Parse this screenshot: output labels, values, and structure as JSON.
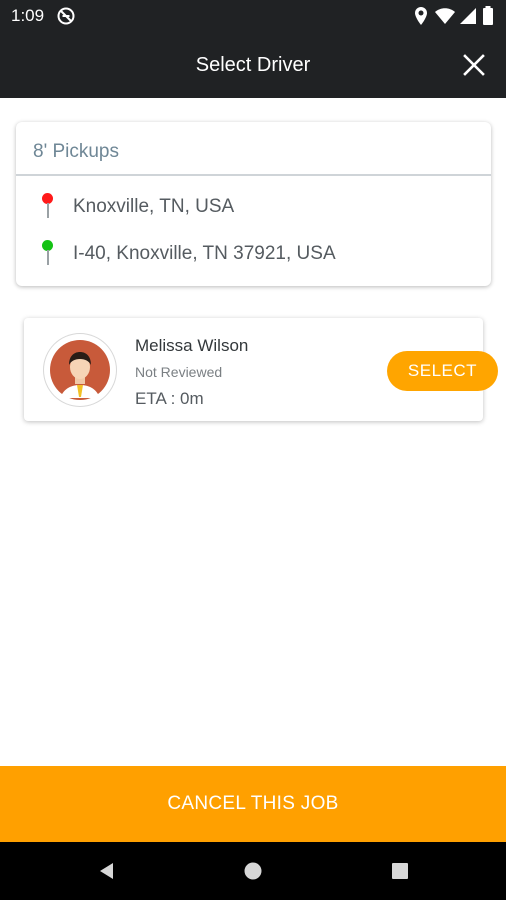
{
  "status_bar": {
    "time": "1:09",
    "left_icon": "do-not-disturb-icon",
    "right_icons": [
      "location-icon",
      "wifi-icon",
      "cellular-signal-icon",
      "battery-icon"
    ]
  },
  "app_bar": {
    "title": "Select Driver",
    "close_icon": "close-icon"
  },
  "route_card": {
    "vehicle_type": "8' Pickups",
    "pickup": {
      "address": "Knoxville, TN, USA",
      "pin_color": "#ff1a1a"
    },
    "dropoff": {
      "address": "I-40, Knoxville, TN 37921, USA",
      "pin_color": "#14c214"
    }
  },
  "driver": {
    "name": "Melissa Wilson",
    "review_status": "Not Reviewed",
    "eta": "ETA : 0m",
    "select_label": "SELECT"
  },
  "footer": {
    "cancel_label": "CANCEL THIS JOB"
  },
  "nav": {
    "back_icon": "back-icon",
    "home_icon": "home-icon",
    "recents_icon": "recents-icon"
  },
  "colors": {
    "accent": "#ffa500",
    "app_bar": "#202224"
  }
}
